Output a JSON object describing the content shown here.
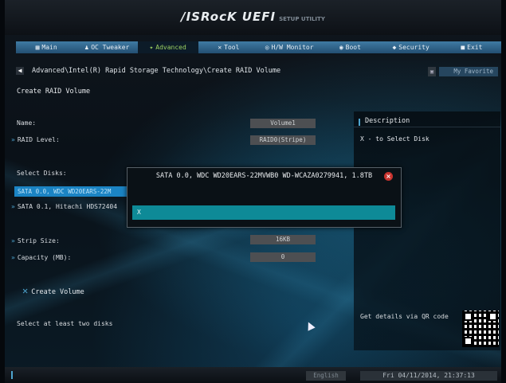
{
  "header": {
    "brand": "/ISRocK UEFI",
    "subtitle": "SETUP UTILITY"
  },
  "tabs": [
    {
      "label": "Main",
      "icon": "menu-icon"
    },
    {
      "label": "OC Tweaker",
      "icon": "person-icon"
    },
    {
      "label": "Advanced",
      "icon": "advanced-icon",
      "active": true
    },
    {
      "label": "Tool",
      "icon": "tool-icon"
    },
    {
      "label": "H/W Monitor",
      "icon": "monitor-icon"
    },
    {
      "label": "Boot",
      "icon": "boot-icon"
    },
    {
      "label": "Security",
      "icon": "shield-icon"
    },
    {
      "label": "Exit",
      "icon": "exit-icon"
    }
  ],
  "breadcrumb": "Advanced\\Intel(R) Rapid Storage Technology\\Create RAID Volume",
  "favorite": "My Favorite",
  "page_title": "Create RAID Volume",
  "fields": {
    "name_label": "Name:",
    "name_value": "Volume1",
    "raid_label": "RAID Level:",
    "raid_value": "RAID0(Stripe)",
    "select_disks_label": "Select Disks:",
    "disk0": "SATA 0.0, WDC WD20EARS-22M",
    "disk1": "SATA 0.1, Hitachi HDS72404",
    "strip_label": "Strip Size:",
    "strip_value": "16KB",
    "capacity_label": "Capacity (MB):",
    "capacity_value": "0"
  },
  "create_volume": "Create Volume",
  "note": "Select at least two disks",
  "description": {
    "title": "Description",
    "text": "X - to Select Disk",
    "qr_label": "Get details via QR code"
  },
  "popup": {
    "title": "SATA 0.0, WDC WD20EARS-22MVWB0 WD-WCAZA0279941, 1.8TB",
    "option": "X"
  },
  "status": {
    "language": "English",
    "datetime": "Fri 04/11/2014, 21:37:13"
  },
  "colors": {
    "accent": "#4ea5cf",
    "selected": "#1b84c4",
    "popup_option": "#0e8a97",
    "close": "#c8332e"
  }
}
